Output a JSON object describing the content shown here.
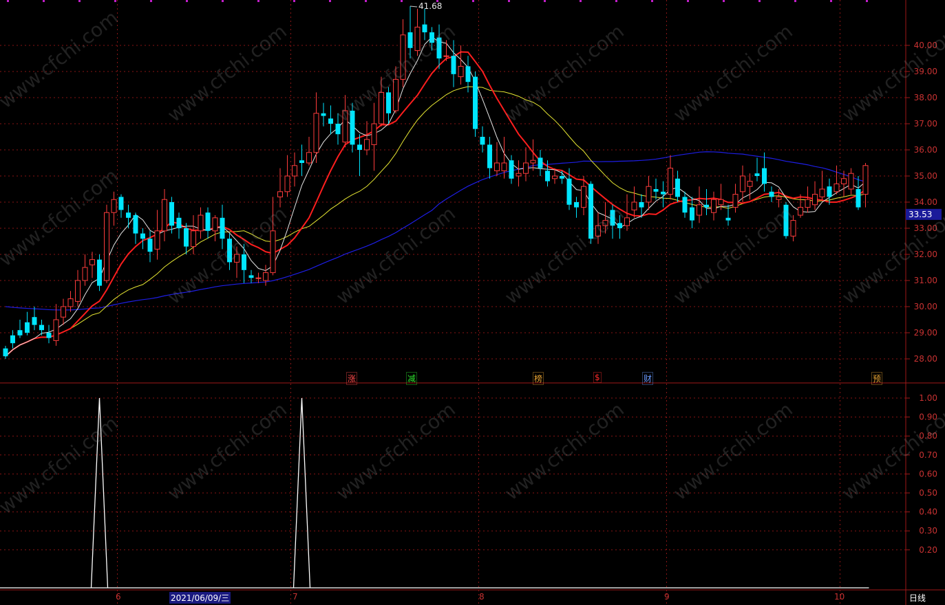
{
  "chart_data": [
    {
      "type": "candlestick",
      "ylim": [
        27.6,
        41.8
      ],
      "yticks": [
        "40.00",
        "39.00",
        "38.00",
        "37.00",
        "36.00",
        "35.00",
        "34.00",
        "33.00",
        "32.00",
        "31.00",
        "30.00",
        "29.00",
        "28.00"
      ],
      "grid": true,
      "high_label": "41.68",
      "current_price": "33.53",
      "up_color": "#ff3c3c",
      "down_color": "#00e5ff",
      "candles": [
        [
          28.4,
          28.1,
          28.5,
          28.0
        ],
        [
          28.9,
          28.6,
          29.1,
          28.4
        ],
        [
          29.1,
          28.9,
          29.5,
          28.8
        ],
        [
          29.4,
          29.0,
          29.8,
          28.9
        ],
        [
          29.6,
          29.3,
          30.0,
          29.1
        ],
        [
          29.3,
          29.1,
          29.5,
          28.9
        ],
        [
          29.0,
          28.8,
          29.3,
          28.6
        ],
        [
          28.7,
          29.5,
          30.1,
          28.5
        ],
        [
          29.6,
          30.0,
          30.3,
          29.3
        ],
        [
          30.0,
          30.3,
          30.6,
          29.8
        ],
        [
          30.2,
          31.0,
          31.4,
          30.0
        ],
        [
          31.0,
          31.5,
          32.0,
          30.8
        ],
        [
          31.6,
          31.8,
          32.1,
          31.1
        ],
        [
          31.8,
          30.8,
          32.0,
          30.6
        ],
        [
          31.0,
          33.6,
          33.9,
          30.9
        ],
        [
          33.6,
          34.1,
          34.4,
          33.1
        ],
        [
          34.2,
          33.7,
          34.3,
          33.4
        ],
        [
          33.6,
          33.4,
          33.9,
          33.0
        ],
        [
          33.5,
          32.8,
          33.6,
          32.4
        ],
        [
          32.8,
          32.6,
          33.0,
          32.2
        ],
        [
          32.6,
          32.1,
          32.9,
          31.7
        ],
        [
          32.2,
          32.9,
          33.7,
          31.8
        ],
        [
          32.9,
          34.1,
          34.5,
          32.5
        ],
        [
          34.0,
          33.1,
          34.2,
          32.8
        ],
        [
          33.4,
          33.0,
          33.6,
          32.6
        ],
        [
          33.0,
          32.3,
          33.2,
          32.0
        ],
        [
          32.3,
          32.9,
          33.5,
          32.0
        ],
        [
          32.9,
          33.5,
          33.8,
          32.6
        ],
        [
          33.6,
          32.9,
          33.8,
          32.6
        ],
        [
          32.9,
          33.4,
          33.5,
          32.5
        ],
        [
          33.4,
          32.6,
          33.9,
          32.2
        ],
        [
          32.6,
          31.7,
          32.8,
          31.4
        ],
        [
          31.7,
          32.0,
          32.3,
          31.1
        ],
        [
          32.0,
          31.4,
          32.4,
          30.9
        ],
        [
          31.2,
          31.1,
          31.4,
          30.9
        ],
        [
          31.1,
          31.1,
          31.3,
          30.9
        ],
        [
          31.0,
          31.3,
          31.6,
          30.8
        ],
        [
          31.3,
          32.9,
          34.2,
          31.2
        ],
        [
          34.2,
          34.4,
          35.3,
          33.8
        ],
        [
          34.4,
          35.0,
          35.8,
          34.2
        ],
        [
          35.0,
          35.4,
          35.9,
          34.6
        ],
        [
          35.6,
          35.5,
          36.2,
          35.0
        ],
        [
          35.5,
          35.9,
          36.5,
          35.4
        ],
        [
          35.9,
          37.4,
          38.2,
          35.5
        ],
        [
          37.4,
          37.3,
          37.8,
          36.9
        ],
        [
          37.2,
          37.0,
          37.7,
          36.6
        ],
        [
          37.0,
          36.6,
          37.4,
          36.2
        ],
        [
          36.3,
          37.5,
          38.1,
          36.1
        ],
        [
          37.5,
          36.2,
          37.8,
          35.9
        ],
        [
          36.2,
          36.0,
          36.6,
          35.0
        ],
        [
          36.0,
          36.4,
          37.1,
          35.8
        ],
        [
          36.2,
          37.0,
          37.8,
          35.2
        ],
        [
          37.0,
          38.2,
          38.8,
          36.9
        ],
        [
          38.2,
          37.4,
          38.4,
          37.0
        ],
        [
          37.5,
          38.7,
          39.2,
          37.4
        ],
        [
          38.7,
          40.4,
          41.0,
          38.4
        ],
        [
          40.5,
          39.9,
          41.5,
          39.5
        ],
        [
          39.8,
          40.7,
          41.4,
          39.6
        ],
        [
          40.8,
          40.5,
          41.4,
          40.2
        ],
        [
          40.5,
          40.1,
          40.7,
          39.8
        ],
        [
          40.3,
          39.5,
          40.8,
          39.1
        ],
        [
          39.6,
          39.6,
          40.2,
          39.4
        ],
        [
          39.6,
          38.9,
          40.2,
          38.4
        ],
        [
          38.8,
          39.2,
          40.0,
          38.5
        ],
        [
          39.2,
          38.6,
          39.6,
          38.2
        ],
        [
          38.8,
          36.8,
          39.0,
          36.5
        ],
        [
          36.5,
          36.2,
          36.9,
          35.9
        ],
        [
          36.2,
          35.3,
          36.5,
          34.9
        ],
        [
          35.2,
          35.5,
          36.3,
          35.0
        ],
        [
          35.2,
          35.5,
          36.5,
          34.9
        ],
        [
          35.6,
          34.9,
          35.8,
          34.7
        ],
        [
          35.0,
          35.1,
          35.6,
          34.6
        ],
        [
          35.1,
          35.5,
          36.1,
          34.8
        ],
        [
          35.5,
          35.6,
          36.4,
          35.2
        ],
        [
          35.7,
          35.3,
          36.0,
          35.0
        ],
        [
          35.2,
          34.8,
          35.6,
          34.6
        ],
        [
          34.9,
          35.0,
          35.3,
          34.7
        ],
        [
          35.0,
          34.9,
          35.2,
          34.7
        ],
        [
          34.9,
          33.9,
          35.3,
          33.7
        ],
        [
          34.0,
          33.8,
          34.2,
          33.4
        ],
        [
          33.8,
          34.6,
          35.0,
          33.5
        ],
        [
          34.7,
          32.6,
          34.8,
          32.4
        ],
        [
          32.7,
          33.1,
          33.6,
          32.4
        ],
        [
          33.1,
          33.3,
          34.0,
          32.8
        ],
        [
          33.7,
          33.1,
          33.9,
          32.6
        ],
        [
          33.2,
          33.0,
          33.5,
          32.6
        ],
        [
          33.1,
          33.4,
          34.3,
          32.9
        ],
        [
          33.7,
          34.0,
          34.6,
          33.4
        ],
        [
          34.0,
          33.8,
          34.3,
          33.4
        ],
        [
          34.0,
          34.6,
          35.0,
          33.7
        ],
        [
          34.5,
          34.4,
          34.9,
          34.1
        ],
        [
          34.4,
          34.3,
          34.8,
          33.8
        ],
        [
          34.3,
          35.3,
          35.8,
          34.1
        ],
        [
          34.9,
          34.2,
          35.2,
          34.0
        ],
        [
          34.2,
          33.6,
          34.4,
          33.4
        ],
        [
          33.8,
          33.3,
          34.2,
          33.0
        ],
        [
          33.5,
          33.9,
          34.6,
          33.2
        ],
        [
          33.9,
          33.8,
          34.5,
          33.5
        ],
        [
          33.6,
          34.1,
          34.4,
          33.3
        ],
        [
          33.9,
          34.1,
          34.7,
          33.7
        ],
        [
          33.4,
          33.3,
          33.9,
          33.1
        ],
        [
          33.8,
          34.3,
          34.7,
          33.6
        ],
        [
          34.4,
          35.0,
          35.4,
          34.0
        ],
        [
          34.6,
          34.8,
          35.1,
          34.1
        ],
        [
          35.1,
          35.0,
          35.7,
          34.8
        ],
        [
          35.3,
          34.7,
          35.9,
          34.4
        ],
        [
          34.4,
          34.2,
          34.6,
          34.0
        ],
        [
          34.1,
          34.2,
          34.5,
          33.8
        ],
        [
          33.9,
          32.7,
          34.0,
          32.6
        ],
        [
          32.7,
          33.3,
          33.5,
          32.5
        ],
        [
          33.5,
          33.8,
          34.3,
          33.4
        ],
        [
          33.8,
          34.1,
          34.6,
          33.6
        ],
        [
          33.9,
          34.3,
          34.8,
          33.7
        ],
        [
          34.2,
          34.5,
          35.2,
          34.1
        ],
        [
          34.6,
          34.2,
          34.9,
          33.9
        ],
        [
          34.4,
          34.7,
          35.4,
          34.3
        ],
        [
          34.7,
          34.9,
          35.2,
          34.2
        ],
        [
          34.5,
          35.1,
          35.3,
          34.3
        ],
        [
          34.5,
          33.8,
          35.0,
          33.7
        ],
        [
          34.3,
          35.4,
          35.5,
          33.8
        ]
      ],
      "events": [
        "涨",
        "减",
        "榜",
        "$",
        "财",
        "预"
      ],
      "x_tick_labels": [
        "6",
        "2021/06/09/三",
        "7",
        "8",
        "9",
        "10"
      ]
    },
    {
      "type": "line",
      "ylim": [
        0,
        1.0
      ],
      "yticks": [
        "1.00",
        "0.90",
        "0.80",
        "0.70",
        "0.60",
        "0.50",
        "0.40",
        "0.30",
        "0.20"
      ],
      "spike_indices": [
        13,
        41
      ],
      "spike_value": 1.0
    }
  ],
  "period_label": "日线",
  "watermark": "www.cfchi.com"
}
